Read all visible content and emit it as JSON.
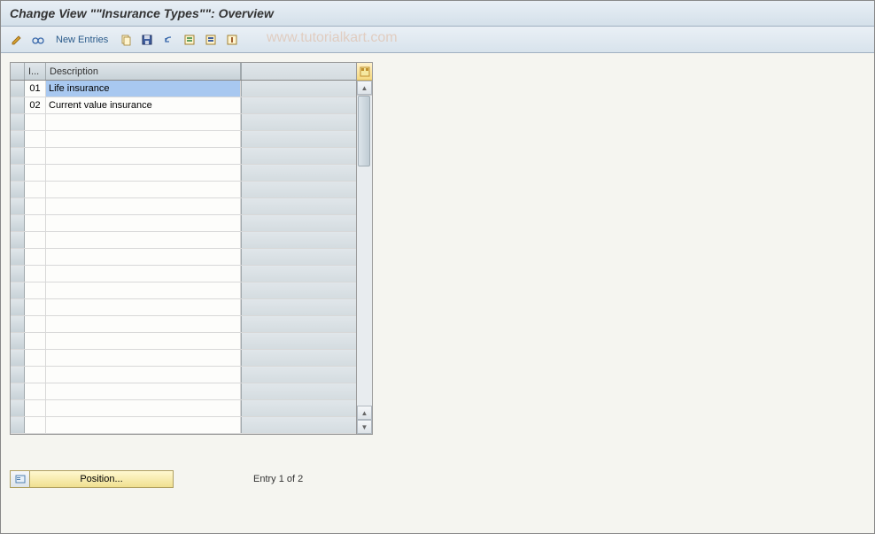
{
  "title": "Change View \"\"Insurance Types\"\": Overview",
  "toolbar": {
    "new_entries": "New Entries",
    "icons": {
      "pencil": "pencil-icon",
      "glasses": "glasses-icon",
      "copy": "copy-icon",
      "save": "save-icon",
      "undo": "undo-icon",
      "select_all": "select-all-icon",
      "deselect": "deselect-icon",
      "config": "config-icon"
    }
  },
  "watermark": "www.tutorialkart.com",
  "grid": {
    "headers": {
      "id": "I...",
      "description": "Description"
    },
    "rows": [
      {
        "id": "01",
        "description": "Life insurance",
        "highlighted": true
      },
      {
        "id": "02",
        "description": "Current value insurance",
        "highlighted": false
      }
    ],
    "empty_rows": 19
  },
  "footer": {
    "position_label": "Position...",
    "entry_status": "Entry 1 of 2"
  }
}
